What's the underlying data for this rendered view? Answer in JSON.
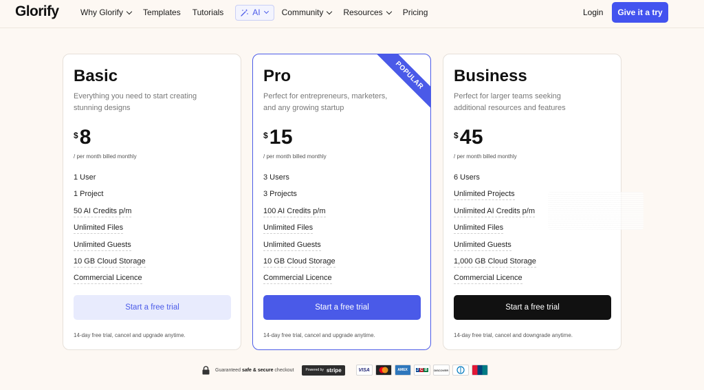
{
  "nav": {
    "logo": "Glorify",
    "links": [
      {
        "label": "Why Glorify",
        "dropdown": true
      },
      {
        "label": "Templates",
        "dropdown": false
      },
      {
        "label": "Tutorials",
        "dropdown": false
      }
    ],
    "ai_label": "AI",
    "links_after": [
      {
        "label": "Community",
        "dropdown": true
      },
      {
        "label": "Resources",
        "dropdown": true
      },
      {
        "label": "Pricing",
        "dropdown": false
      }
    ],
    "login": "Login",
    "cta": "Give it a try"
  },
  "plans": {
    "basic": {
      "name": "Basic",
      "description": "Everything you need to start creating stunning designs",
      "currency": "$",
      "price": "8",
      "period": "/ per month billed monthly",
      "features": [
        "1 User",
        "1 Project",
        "50 AI Credits p/m",
        "Unlimited Files",
        "Unlimited Guests",
        "10 GB Cloud Storage",
        "Commercial Licence"
      ],
      "cta": "Start a free trial",
      "footnote": "14-day free trial, cancel and upgrade anytime."
    },
    "pro": {
      "name": "Pro",
      "badge": "POPULAR",
      "description": "Perfect for entrepreneurs, marketers, and any growing startup",
      "currency": "$",
      "price": "15",
      "period": "/ per month billed monthly",
      "features": [
        "3 Users",
        "3 Projects",
        "100 AI Credits p/m",
        "Unlimited Files",
        "Unlimited Guests",
        "10 GB Cloud Storage",
        "Commercial Licence"
      ],
      "cta": "Start a free trial",
      "footnote": "14-day free trial, cancel and upgrade anytime."
    },
    "business": {
      "name": "Business",
      "description": "Perfect for larger teams seeking additional resources and features",
      "currency": "$",
      "price": "45",
      "period": "/ per month billed monthly",
      "features": [
        "6 Users",
        "Unlimited Projects",
        "Unlimited AI Credits p/m",
        "Unlimited Files",
        "Unlimited Guests",
        "1,000 GB Cloud Storage",
        "Commercial Licence"
      ],
      "cta": "Start a free trial",
      "footnote": "14-day free trial, cancel and downgrade anytime."
    }
  },
  "checkout": {
    "text_pre": "Guaranteed",
    "text_bold": "safe & secure",
    "text_post": "checkout",
    "powered_by": "Powered by",
    "stripe": "stripe",
    "payment_methods": [
      "VISA",
      "Mastercard",
      "AMEX",
      "JCB",
      "DISCOVER",
      "Diners",
      "UnionPay"
    ]
  },
  "colors": {
    "accent": "#4a5ae8",
    "background": "#fdf8f3",
    "dark_button": "#111111"
  }
}
